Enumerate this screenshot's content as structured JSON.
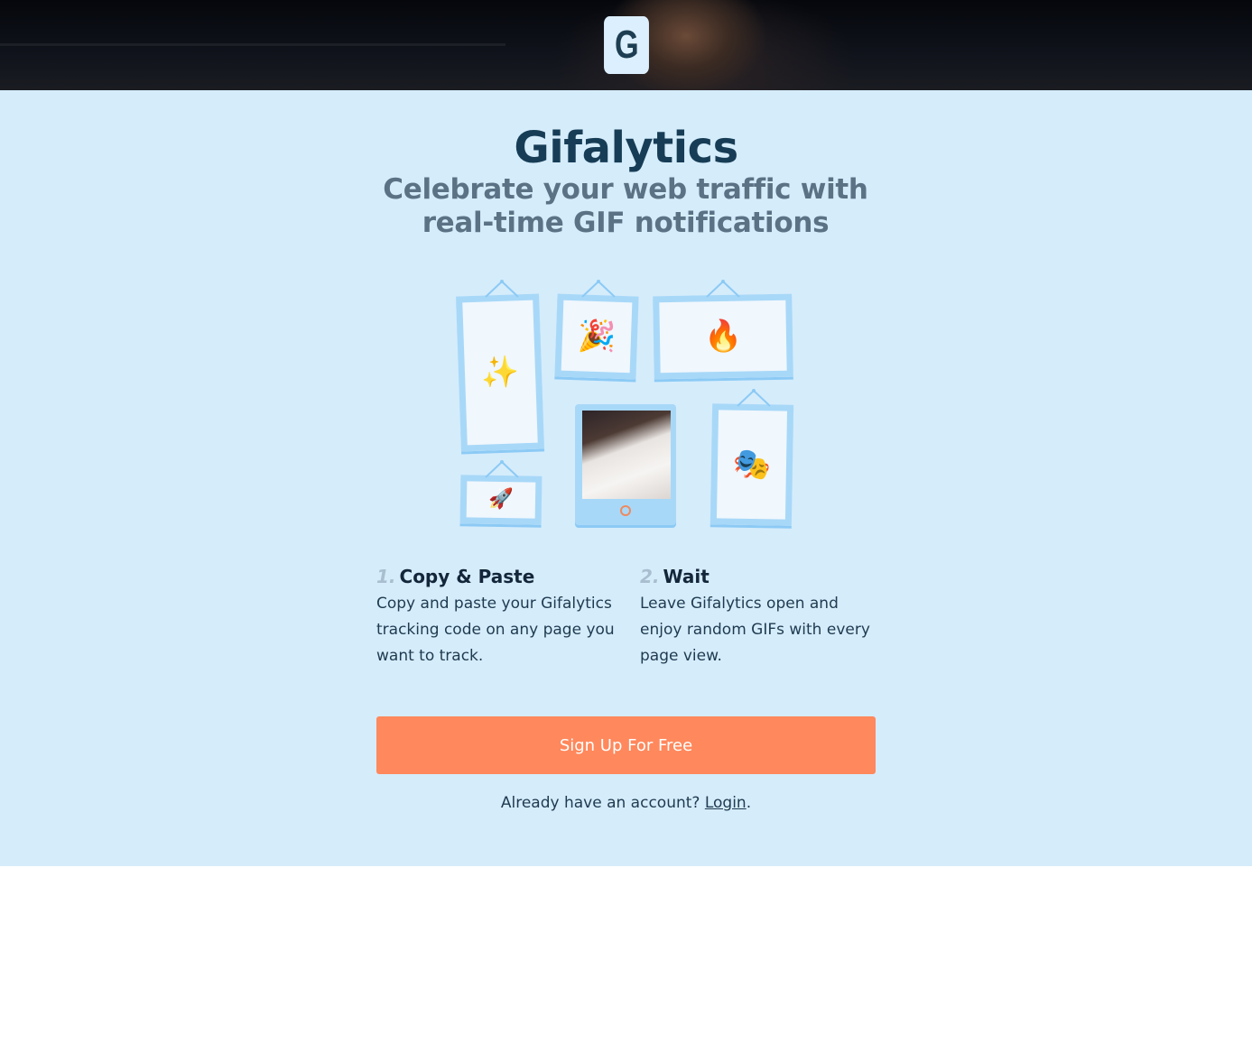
{
  "header": {
    "logo_letter": "G"
  },
  "hero": {
    "title": "Gifalytics",
    "subtitle": "Celebrate your web traffic with real-time GIF notifications"
  },
  "gallery": {
    "frames": [
      {
        "icon": "sparkles-icon",
        "glyph": "✨"
      },
      {
        "icon": "party-popper-icon",
        "glyph": "🎉"
      },
      {
        "icon": "fire-icon",
        "glyph": "🔥"
      },
      {
        "icon": "rocket-icon",
        "glyph": "🚀"
      },
      {
        "icon": "theater-masks-icon",
        "glyph": "🎭"
      }
    ]
  },
  "steps": [
    {
      "number": "1.",
      "title": "Copy & Paste",
      "text": "Copy and paste your Gifalytics tracking code on any page you want to track."
    },
    {
      "number": "2.",
      "title": "Wait",
      "text": "Leave Gifalytics open and enjoy random GIFs with every page view."
    }
  ],
  "cta": {
    "label": "Sign Up For Free"
  },
  "login": {
    "prompt": "Already have an account?",
    "link_label": "Login",
    "suffix": "."
  },
  "colors": {
    "background": "#d5ecfb",
    "title": "#173d56",
    "subtitle": "#5b7285",
    "frame": "#a8d8f8",
    "cta": "#ff885c"
  }
}
